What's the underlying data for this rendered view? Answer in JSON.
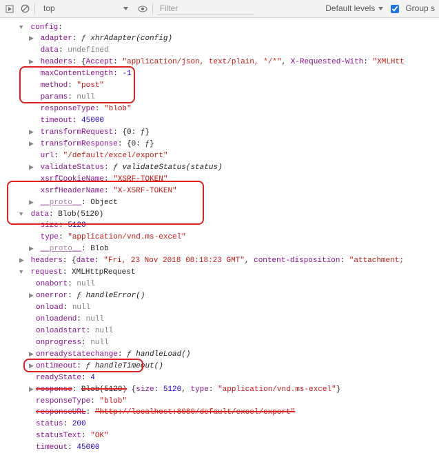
{
  "toolbar": {
    "context": "top",
    "filter_placeholder": "Filter",
    "levels_label": "Default levels",
    "group_label": "Group s"
  },
  "tree": {
    "config_label": "config",
    "config": {
      "adapter_k": "adapter",
      "adapter_v": "xhrAdapter(config)",
      "data_k": "data",
      "data_v": "undefined",
      "headers_k": "headers",
      "headers_open": "{",
      "accept_k": "Accept",
      "accept_v": "\"application/json, text/plain, */*\"",
      "xreq_k": "X-Requested-With",
      "xreq_v": "\"XMLHtt",
      "maxlen_k": "maxContentLength",
      "maxlen_v": "-1",
      "method_k": "method",
      "method_v": "\"post\"",
      "params_k": "params",
      "params_v": "null",
      "rtype_k": "responseType",
      "rtype_v": "\"blob\"",
      "timeout_k": "timeout",
      "timeout_v": "45000",
      "treq_k": "transformRequest",
      "treq_v": "{0: ƒ}",
      "tres_k": "transformResponse",
      "tres_v": "{0: ƒ}",
      "url_k": "url",
      "url_v": "\"/default/excel/export\"",
      "vstat_k": "validateStatus",
      "vstat_v": "validateStatus(status)",
      "xck_k": "xsrfCookieName",
      "xck_v": "\"XSRF-TOKEN\"",
      "xhk_k": "xsrfHeaderName",
      "xhk_v": "\"X-XSRF-TOKEN\"",
      "proto_v": "Object"
    },
    "data_label": "data",
    "data_type_label": "Blob(5120)",
    "data_block": {
      "size_k": "size",
      "size_v": "5120",
      "type_k": "type",
      "type_v": "\"application/vnd.ms-excel\"",
      "proto_v": "Blob"
    },
    "headers2_k": "headers",
    "headers2_open": "{",
    "headers2": {
      "date_k": "date",
      "date_v": "\"Fri, 23 Nov 2018 08:18:23 GMT\"",
      "cdisp_k": "content-disposition",
      "cdisp_v": "\"attachment;"
    },
    "request_k": "request",
    "request_v": "XMLHttpRequest",
    "req": {
      "onabort_k": "onabort",
      "onabort_v": "null",
      "onerror_k": "onerror",
      "onerror_v": "handleError()",
      "onload_k": "onload",
      "onload_v": "null",
      "onloadend_k": "onloadend",
      "onloadend_v": "null",
      "onloadstart_k": "onloadstart",
      "onloadstart_v": "null",
      "onprogress_k": "onprogress",
      "onprogress_v": "null",
      "orsc_k": "onreadystatechange",
      "orsc_v": "handleLoad()",
      "ontimeout_k": "ontimeout",
      "ontimeout_v": "handleTimeout()",
      "ready_k": "readyState",
      "ready_v": "4",
      "resp_k": "response",
      "resp_v_pre": "Blob(5120)",
      "resp_open": "{",
      "resp_size_k": "size",
      "resp_size_v": "5120",
      "resp_type_k": "type",
      "resp_type_v": "\"application/vnd.ms-excel\"",
      "resp_close": "}",
      "rtype_k": "responseType",
      "rtype_v": "\"blob\"",
      "rurl_k": "responseURL",
      "rurl_v": "\"http://localhost:8080/default/excel/export\"",
      "status_k": "status",
      "status_v": "200",
      "stext_k": "statusText",
      "stext_v": "\"OK\"",
      "timeout_k": "timeout",
      "timeout_v": "45000"
    },
    "proto_label": "__proto__"
  }
}
